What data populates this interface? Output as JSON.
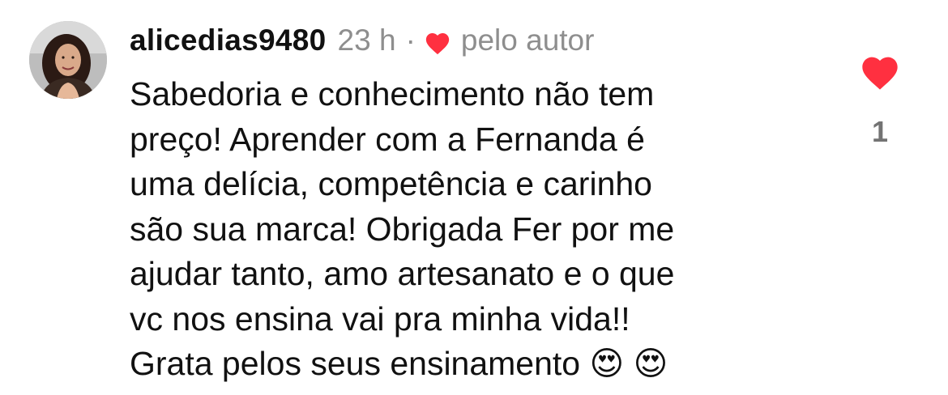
{
  "comment": {
    "username": "alicedias9480",
    "time": "23 h",
    "separator": "·",
    "liked_by_author_label": "pelo autor",
    "text": "Sabedoria e conhecimento não tem\npreço! Aprender com a Fernanda é\numa delícia, competência e carinho\nsão sua marca! Obrigada Fer por me\najudar tanto, amo artesanato e o que\nvc nos ensina vai pra minha vida!!\nGrata pelos seus ensinamento 😍 😍",
    "like_count": "1"
  },
  "colors": {
    "heart_red": "#ff3040",
    "muted_text": "#8e8e8e",
    "primary_text": "#111111"
  },
  "icons": {
    "author_like": "heart-icon",
    "like_button": "heart-icon"
  }
}
